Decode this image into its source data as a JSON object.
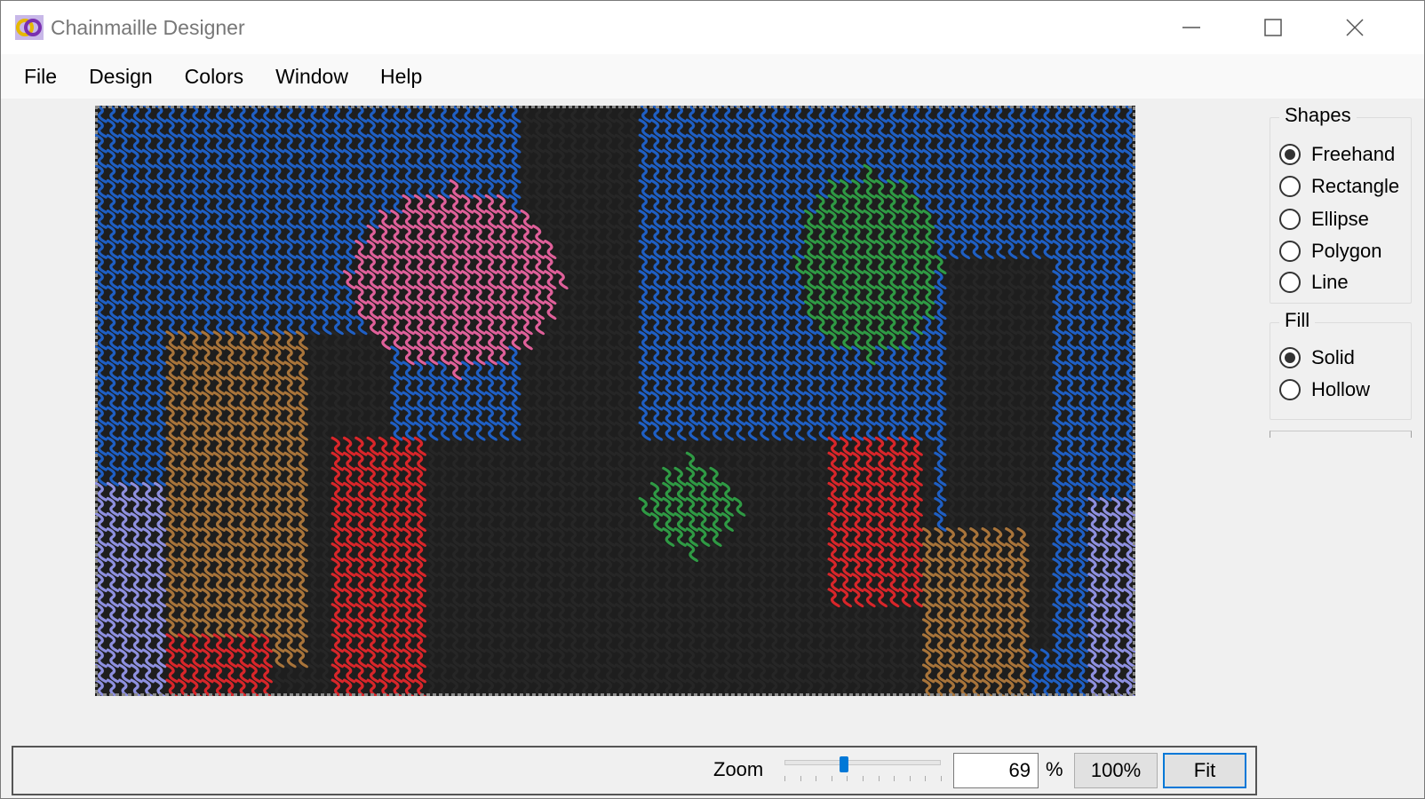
{
  "window": {
    "title": "Chainmaille Designer",
    "icon": "app-rings-icon"
  },
  "menu": [
    "File",
    "Design",
    "Colors",
    "Window",
    "Help"
  ],
  "panel": {
    "shapes": {
      "legend": "Shapes",
      "options": [
        "Freehand",
        "Rectangle",
        "Ellipse",
        "Polygon",
        "Line"
      ],
      "selected": "Freehand"
    },
    "fill": {
      "legend": "Fill",
      "options": [
        "Solid",
        "Hollow"
      ],
      "selected": "Solid"
    }
  },
  "status": {
    "zoom_label": "Zoom",
    "zoom_value": "69",
    "zoom_percent_sign": "%",
    "zoom_slider_fraction": 0.38,
    "btn_100": "100%",
    "btn_fit": "Fit"
  },
  "design": {
    "palette": {
      "blue": "#1f5fc4",
      "black": "#262626",
      "pink": "#e0609a",
      "red": "#d9262a",
      "brown": "#a8743a",
      "green": "#2f9a44",
      "lavender": "#8e90e0",
      "gray": "#8a8a8a"
    }
  }
}
